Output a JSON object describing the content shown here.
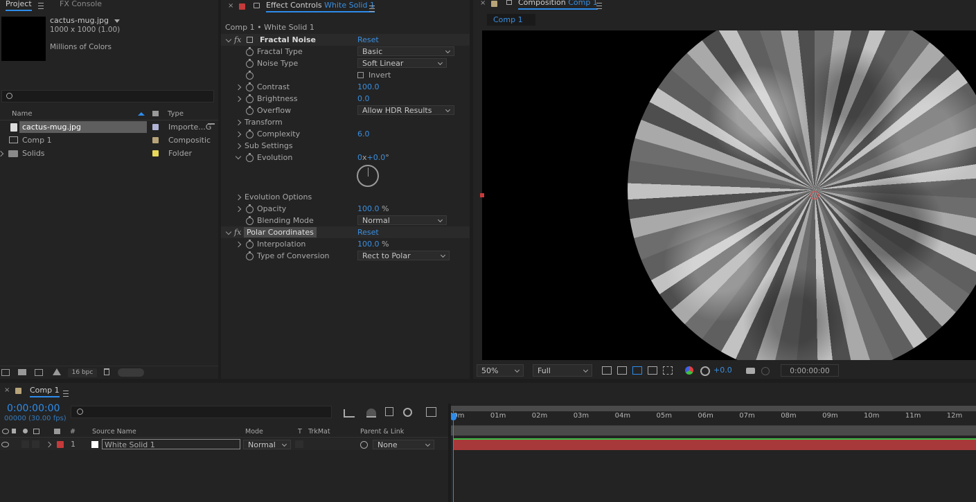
{
  "project": {
    "tabs": [
      "Project",
      "FX Console"
    ],
    "file": {
      "name": "cactus-mug.jpg",
      "dims": "1000 x 1000 (1.00)",
      "colors": "Millions of Colors"
    },
    "columns": {
      "name": "Name",
      "type": "Type"
    },
    "items": [
      {
        "name": "cactus-mug.jpg",
        "type": "Importe...G",
        "color": "#b0b3d6"
      },
      {
        "name": "Comp 1",
        "type": "Compositic",
        "color": "#b8a47a"
      },
      {
        "name": "Solids",
        "type": "Folder",
        "color": "#e8d85a"
      }
    ],
    "bpc": "16 bpc"
  },
  "effects": {
    "tab_label": "Effect Controls",
    "tab_target": "White Solid 1",
    "breadcrumb": "Comp 1 • White Solid 1",
    "fractal": {
      "title": "Fractal Noise",
      "reset": "Reset",
      "fractal_type": {
        "label": "Fractal Type",
        "value": "Basic"
      },
      "noise_type": {
        "label": "Noise Type",
        "value": "Soft Linear"
      },
      "invert": "Invert",
      "contrast": {
        "label": "Contrast",
        "value": "100.0"
      },
      "brightness": {
        "label": "Brightness",
        "value": "0.0"
      },
      "overflow": {
        "label": "Overflow",
        "value": "Allow HDR Results"
      },
      "transform": "Transform",
      "complexity": {
        "label": "Complexity",
        "value": "6.0"
      },
      "sub_settings": "Sub Settings",
      "evolution": {
        "label": "Evolution",
        "value_rev": "0",
        "x": "x",
        "value_deg": "+0.0",
        "deg": "°"
      },
      "evolution_options": "Evolution Options",
      "opacity": {
        "label": "Opacity",
        "value": "100.0",
        "unit": "%"
      },
      "blending": {
        "label": "Blending Mode",
        "value": "Normal"
      }
    },
    "polar": {
      "title": "Polar Coordinates",
      "reset": "Reset",
      "interpolation": {
        "label": "Interpolation",
        "value": "100.0",
        "unit": "%"
      },
      "conversion": {
        "label": "Type of Conversion",
        "value": "Rect to Polar"
      }
    }
  },
  "composition": {
    "tab_label": "Composition",
    "tab_target": "Comp 1",
    "subtab": "Comp 1",
    "zoom": "50%",
    "resolution": "Full",
    "exposure": "+0.0",
    "timecode": "0:00:00:00"
  },
  "timeline": {
    "tab": "Comp 1",
    "timecode": "0:00:00:00",
    "frames": "00000 (30.00 fps)",
    "headers": {
      "num": "#",
      "source": "Source Name",
      "mode": "Mode",
      "t": "T",
      "trkmat": "TrkMat",
      "parent": "Parent & Link"
    },
    "layer": {
      "num": "1",
      "name": "White Solid 1",
      "mode": "Normal",
      "parent": "None"
    },
    "ticks": [
      "00m",
      "01m",
      "02m",
      "03m",
      "04m",
      "05m",
      "06m",
      "07m",
      "08m",
      "09m",
      "10m",
      "11m",
      "12m"
    ]
  },
  "colors": {
    "accent": "#2d8ceb",
    "label_red": "#c53a3a",
    "layer_bar": "#a8393a"
  }
}
